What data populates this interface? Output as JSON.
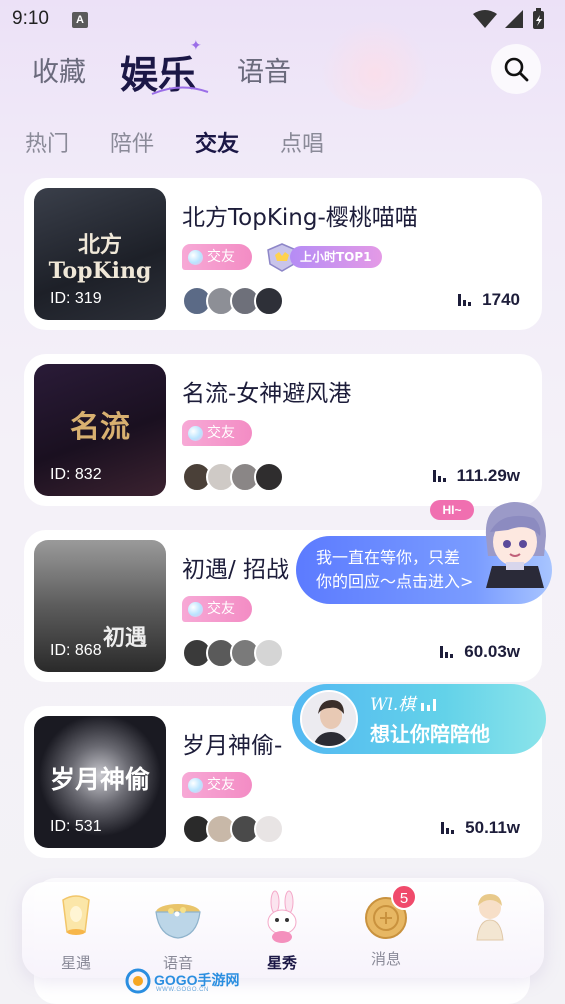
{
  "status_bar": {
    "time": "9:10",
    "notif_letter": "A"
  },
  "top_tabs": [
    {
      "label": "收藏"
    },
    {
      "label": "娱乐",
      "active": true
    },
    {
      "label": "语音"
    }
  ],
  "sub_tabs": [
    {
      "label": "热门"
    },
    {
      "label": "陪伴"
    },
    {
      "label": "交友",
      "active": true
    },
    {
      "label": "点唱"
    }
  ],
  "rooms": [
    {
      "title": "北方TopKing-樱桃喵喵",
      "id_label": "ID: 319",
      "cover_text": "北方 TopKing",
      "tag": "交友",
      "badge": "上小时TOP1",
      "hot": "1740"
    },
    {
      "title": "名流-女神避风港",
      "id_label": "ID: 832",
      "cover_text": "名流",
      "tag": "交友",
      "hot": "111.29w"
    },
    {
      "title": "初遇/ 招战",
      "id_label": "ID: 868",
      "cover_text": "初遇",
      "tag": "交友",
      "hot": "60.03w"
    },
    {
      "title": "岁月神偷-",
      "id_label": "ID: 531",
      "cover_text": "岁月神偷",
      "tag": "交友",
      "hot": "50.11w"
    }
  ],
  "bubble_one": {
    "hi": "HI~",
    "line1": "我一直在等你，只差",
    "line2": "你的回应～点击进入>"
  },
  "bubble_two": {
    "name": "Wl.棋",
    "message": "想让你陪陪他"
  },
  "nav": [
    {
      "label": "星遇",
      "icon": "lantern-icon"
    },
    {
      "label": "语音",
      "icon": "tea-bowl-icon"
    },
    {
      "label": "星秀",
      "icon": "bunny-icon",
      "active": true
    },
    {
      "label": "消息",
      "icon": "mooncake-icon",
      "badge": "5"
    },
    {
      "label": "",
      "icon": "doll-icon"
    }
  ],
  "watermark": {
    "text": "GOGO手游网",
    "sub": "WWW.GOGO.CN"
  },
  "colors": {
    "accent": "#1b1746",
    "tag_pink": "#f38cc4",
    "bubble_blue": "#5c7bff",
    "bubble_cyan": "#53b8f2",
    "badge_red": "#f04a6b"
  }
}
